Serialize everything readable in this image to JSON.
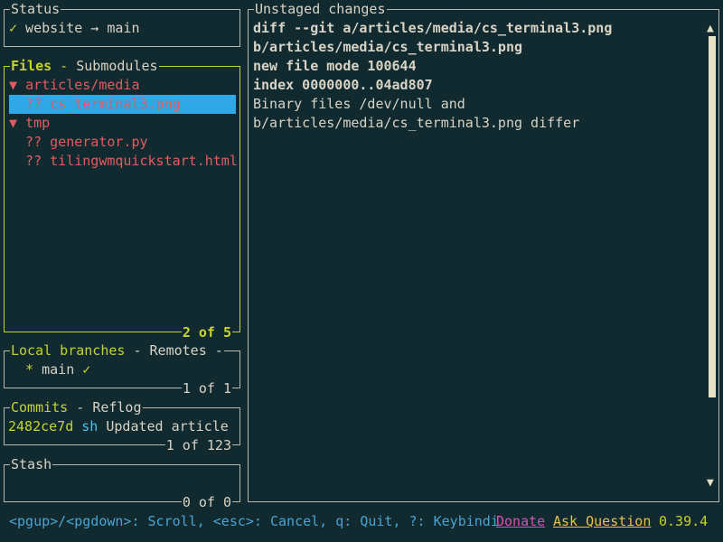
{
  "status": {
    "title": "Status",
    "check": "✓",
    "text": " website → main"
  },
  "files": {
    "title_active": "Files",
    "title_sep": " - ",
    "title_other": "Submodules",
    "counter": "2 of 5",
    "rows": [
      {
        "prefix": "▼ ",
        "text": "articles/media"
      },
      {
        "prefix": "  ?? ",
        "text": "cs_terminal3.png"
      },
      {
        "prefix": "▼ ",
        "text": "tmp"
      },
      {
        "prefix": "  ?? ",
        "text": "generator.py"
      },
      {
        "prefix": "  ?? ",
        "text": "tilingwmquickstart.html"
      }
    ]
  },
  "branches": {
    "title_active": "Local branches",
    "title_sep": " - ",
    "title_other": "Remotes",
    "title_trail": " -",
    "row_prefix": "  * ",
    "row_name": "main",
    "row_check": " ✓",
    "counter": "1 of 1"
  },
  "commits": {
    "title_active": "Commits",
    "title_sep": " - ",
    "title_other": "Reflog",
    "hash": "2482ce7d",
    "author": " sh",
    "message": " Updated article",
    "counter": "1 of 123"
  },
  "stash": {
    "title": "Stash",
    "counter": "0 of 0"
  },
  "diff": {
    "title": "Unstaged changes",
    "lines": [
      "diff --git a/articles/media/cs_terminal3.png",
      "b/articles/media/cs_terminal3.png",
      "new file mode 100644",
      "index 0000000..04ad807",
      "Binary files /dev/null and",
      "b/articles/media/cs_terminal3.png differ"
    ],
    "scroll_up": "▲",
    "scroll_down": "▼"
  },
  "bottom": {
    "hint": "<pgup>/<pgdown>: Scroll, <esc>: Cancel, q: Quit, ?: Keybindi",
    "donate": "Donate",
    "ask": "Ask Question",
    "version": "0.39.4"
  },
  "colors": {
    "background": "#112a30",
    "accent_green": "#c6d32f",
    "red": "#e35b61",
    "cyan": "#4ec0f0",
    "selection": "#2ea9e6"
  }
}
